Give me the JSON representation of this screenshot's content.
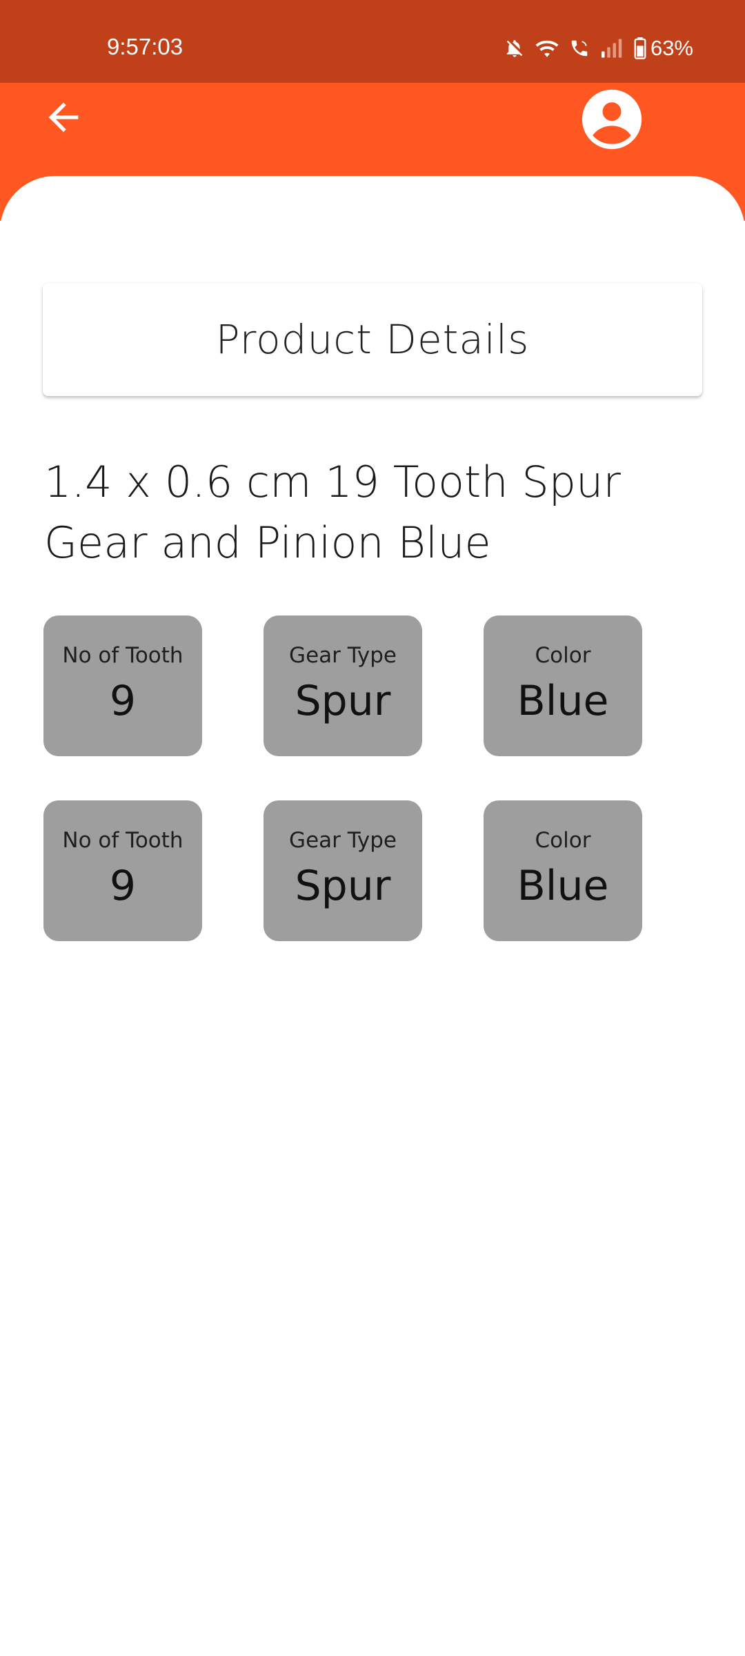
{
  "status_bar": {
    "time": "9:57:03",
    "battery_percent": "63%",
    "icons": [
      "bell-off-icon",
      "wifi-icon",
      "wifi-call-icon",
      "signal-icon",
      "battery-icon"
    ]
  },
  "app_bar": {
    "back_icon": "arrow-left-icon",
    "profile_icon": "account-circle-icon"
  },
  "page": {
    "title": "Product Details",
    "product_name": "1.4 x 0.6 cm 19 Tooth Spur Gear and Pinion Blue"
  },
  "specs": [
    [
      {
        "label": "No of Tooth",
        "value": "9"
      },
      {
        "label": "Gear Type",
        "value": "Spur"
      },
      {
        "label": "Color",
        "value": "Blue"
      }
    ],
    [
      {
        "label": "No of Tooth",
        "value": "9"
      },
      {
        "label": "Gear Type",
        "value": "Spur"
      },
      {
        "label": "Color",
        "value": "Blue"
      }
    ]
  ],
  "colors": {
    "status_bar": "#C0401A",
    "app_bar": "#FF5722",
    "tile": "#9E9E9E",
    "sheet": "#FFFFFF"
  }
}
